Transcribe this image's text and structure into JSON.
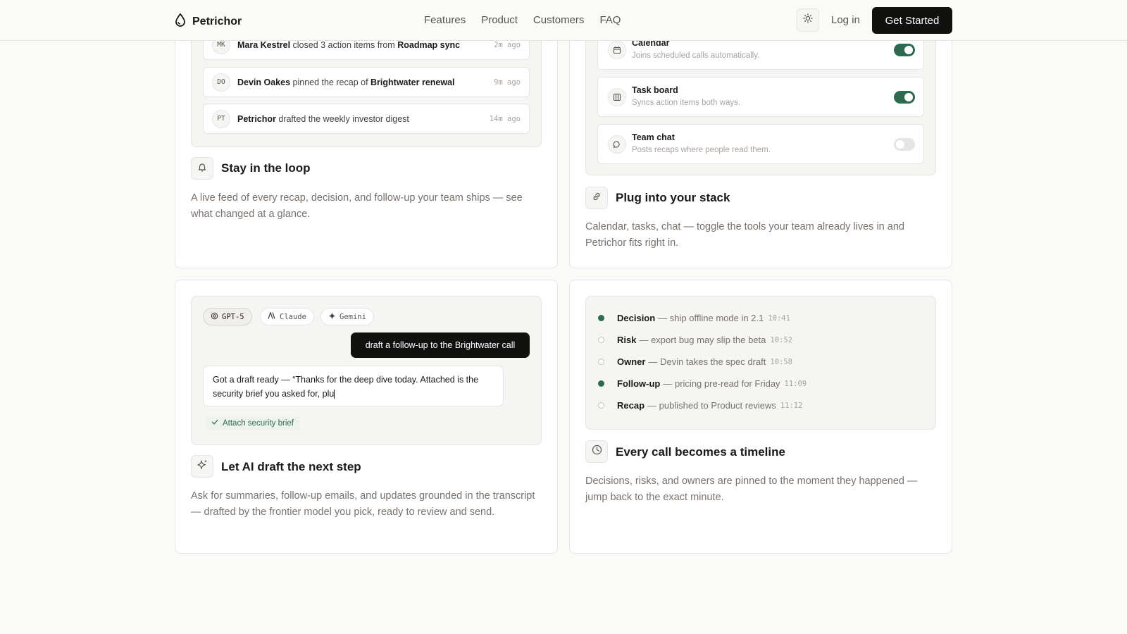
{
  "nav": {
    "brand": "Petrichor",
    "links": [
      "Features",
      "Product",
      "Customers",
      "FAQ"
    ],
    "login": "Log in",
    "cta": "Get Started"
  },
  "activity": {
    "items": [
      {
        "initials": "MK",
        "name": "Mara Kestrel",
        "verb": " closed 3 action items from ",
        "target": "Roadmap sync",
        "time": "2m ago"
      },
      {
        "initials": "DO",
        "name": "Devin Oakes",
        "verb": " pinned the recap of ",
        "target": "Brightwater renewal",
        "time": "9m ago"
      },
      {
        "initials": "PT",
        "name": "Petrichor",
        "verb": " drafted the weekly investor digest",
        "target": "",
        "time": "14m ago"
      }
    ],
    "title": "Stay in the loop",
    "desc": "A live feed of every recap, decision, and follow-up your team ships — see what changed at a glance."
  },
  "integrations": {
    "items": [
      {
        "name": "Calendar",
        "desc": "Joins scheduled calls automatically.",
        "enabled": true
      },
      {
        "name": "Task board",
        "desc": "Syncs action items both ways.",
        "enabled": true
      },
      {
        "name": "Team chat",
        "desc": "Posts recaps where people read them.",
        "enabled": false
      }
    ],
    "title": "Plug into your stack",
    "desc": "Calendar, tasks, chat — toggle the tools your team already lives in and Petrichor fits right in."
  },
  "ai": {
    "models": [
      "GPT-5",
      "Claude",
      "Gemini"
    ],
    "selected_model": "GPT-5",
    "prompt": "draft a follow-up to the Brightwater call",
    "response": "Got a draft ready — “Thanks for the deep dive today. Attached is the security brief you asked for, plu",
    "action": "Attach security brief",
    "title": "Let AI draft the next step",
    "desc": "Ask for summaries, follow-up emails, and updates grounded in the transcript — drafted by the frontier model you pick, ready to review and send."
  },
  "timeline": {
    "items": [
      {
        "label": "Decision",
        "text": "— ship offline mode in 2.1",
        "time": "10:41",
        "filled": true
      },
      {
        "label": "Risk",
        "text": "— export bug may slip the beta",
        "time": "10:52",
        "filled": false
      },
      {
        "label": "Owner",
        "text": "— Devin takes the spec draft",
        "time": "10:58",
        "filled": false
      },
      {
        "label": "Follow-up",
        "text": "— pricing pre-read for Friday",
        "time": "11:09",
        "filled": true
      },
      {
        "label": "Recap",
        "text": "— published to Product reviews",
        "time": "11:12",
        "filled": false
      }
    ],
    "title": "Every call becomes a timeline",
    "desc": "Decisions, risks, and owners are pinned to the moment they happened — jump back to the exact minute."
  },
  "colors": {
    "accent": "#2d6a4f",
    "cta_bg": "#111110",
    "page_bg": "#fafaf9"
  }
}
